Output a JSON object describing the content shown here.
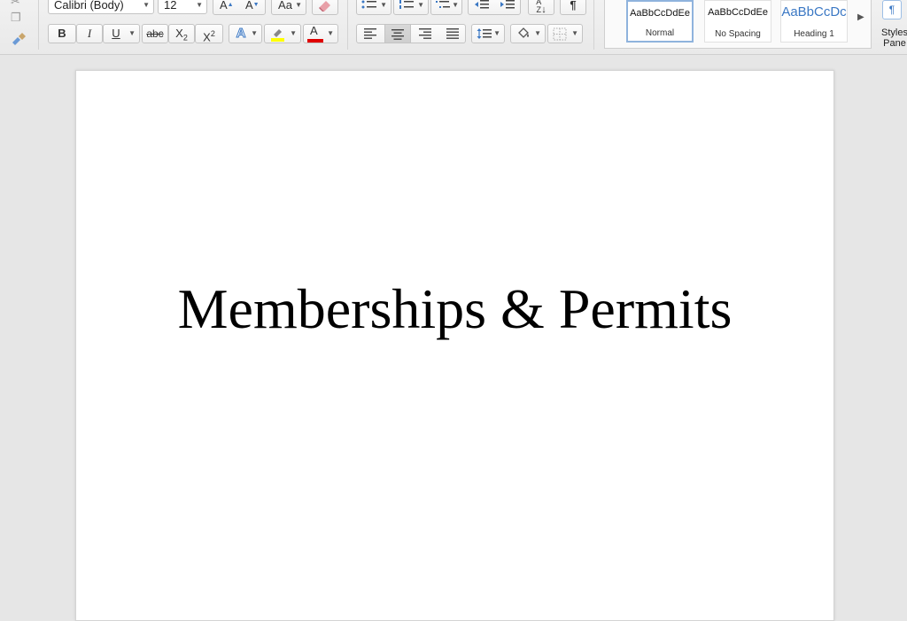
{
  "toolbar": {
    "font_name": "Calibri (Body)",
    "font_size": "12",
    "bold_label": "B",
    "italic_label": "I",
    "underline_label": "U",
    "strikethrough_label": "abc",
    "subscript_label": "X",
    "subscript_sub": "2",
    "superscript_label": "X",
    "superscript_sup": "2",
    "grow_font_label": "A",
    "shrink_font_label": "A",
    "change_case_label": "Aa",
    "text_effects_label": "A",
    "font_color_label": "A",
    "sort_label": "AZ",
    "pilcrow_label": "¶",
    "highlight_color": "#ffff00",
    "font_color": "#e00000"
  },
  "styles": {
    "items": [
      {
        "sample": "AaBbCcDdEe",
        "label": "Normal"
      },
      {
        "sample": "AaBbCcDdEe",
        "label": "No Spacing"
      },
      {
        "sample": "AaBbCcDc",
        "label": "Heading 1"
      }
    ],
    "pane_label_line1": "Styles",
    "pane_label_line2": "Pane"
  },
  "document": {
    "title": "Memberships & Permits"
  },
  "colors": {
    "heading_blue": "#3b78c4"
  }
}
